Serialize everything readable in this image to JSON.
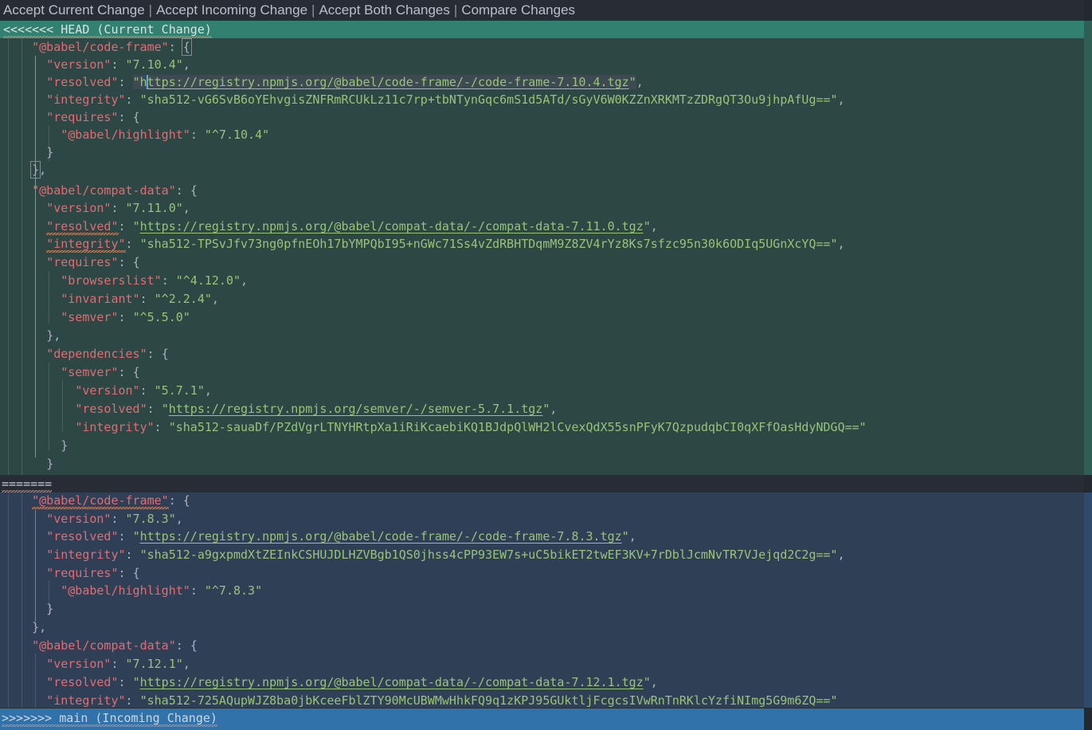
{
  "codelens": {
    "actions": [
      "Accept Current Change",
      "Accept Incoming Change",
      "Accept Both Changes",
      "Compare Changes"
    ],
    "separator": "|"
  },
  "conflict": {
    "current_header": "<<<<<<< HEAD (Current Change)",
    "separator": "=======",
    "incoming_header": ">>>>>>> main (Incoming Change)"
  },
  "colors": {
    "editor_bg": "#282c34",
    "current_region_bg": "#2c4744",
    "current_header_bg": "#32806f",
    "incoming_region_bg": "#2f4056",
    "incoming_header_bg": "#3272ab",
    "key": "#e06c75",
    "string": "#98c379",
    "punctuation": "#abb2bf",
    "caret": "#5aa9e6"
  },
  "current_change": {
    "packages": [
      {
        "name": "@babel/code-frame",
        "version": "7.10.4",
        "resolved": "https://registry.npmjs.org/@babel/code-frame/-/code-frame-7.10.4.tgz",
        "integrity": "sha512-vG6SvB6oYEhvgisZNFRmRCUkLz11c7rp+tbNTynGqc6mS1d5ATd/sGyV6W0KZZnXRKMTzZDRgQT3Ou9jhpAfUg==",
        "requires": [
          {
            "name": "@babel/highlight",
            "range": "^7.10.4"
          }
        ]
      },
      {
        "name": "@babel/compat-data",
        "version": "7.11.0",
        "resolved": "https://registry.npmjs.org/@babel/compat-data/-/compat-data-7.11.0.tgz",
        "integrity": "sha512-TPSvJfv73ng0pfnEOh17bYMPQbI95+nGWc71Ss4vZdRBHTDqmM9Z8ZV4rYz8Ks7sfzc95n30k6ODIq5UGnXcYQ==",
        "requires": [
          {
            "name": "browserslist",
            "range": "^4.12.0"
          },
          {
            "name": "invariant",
            "range": "^2.2.4"
          },
          {
            "name": "semver",
            "range": "^5.5.0"
          }
        ],
        "dependencies": [
          {
            "name": "semver",
            "version": "5.7.1",
            "resolved": "https://registry.npmjs.org/semver/-/semver-5.7.1.tgz",
            "integrity": "sha512-sauaDf/PZdVgrLTNYHRtpXa1iRiKcaebiKQ1BJdpQlWH2lCvexQdX55snPFyK7QzpudqbCI0qXFfOasHdyNDGQ=="
          }
        ]
      }
    ]
  },
  "incoming_change": {
    "packages": [
      {
        "name": "@babel/code-frame",
        "version": "7.8.3",
        "resolved": "https://registry.npmjs.org/@babel/code-frame/-/code-frame-7.8.3.tgz",
        "integrity": "sha512-a9gxpmdXtZEInkCSHUJDLHZVBgb1QS0jhss4cPP93EW7s+uC5bikET2twEF3KV+7rDblJcmNvTR7VJejqd2C2g==",
        "requires": [
          {
            "name": "@babel/highlight",
            "range": "^7.8.3"
          }
        ]
      },
      {
        "name": "@babel/compat-data",
        "version": "7.12.1",
        "resolved": "https://registry.npmjs.org/@babel/compat-data/-/compat-data-7.12.1.tgz",
        "integrity": "sha512-725AQupWJZ8ba0jbKceeFblZTY90McUBWMwHhkFQ9q1zKPJ95GUktljFcgcsIVwRnTnRKlcYzfiNImg5G9m6ZQ=="
      }
    ]
  },
  "lines": {
    "l_key_version": "\"version\"",
    "l_key_resolved": "\"resolved\"",
    "l_key_integrity": "\"integrity\"",
    "l_key_requires": "\"requires\"",
    "l_key_dependencies": "\"dependencies\"",
    "colon": ": ",
    "brace_open": "{",
    "brace_close": "}",
    "brace_close_comma": "},",
    "comma": ",",
    "quote": "\""
  }
}
